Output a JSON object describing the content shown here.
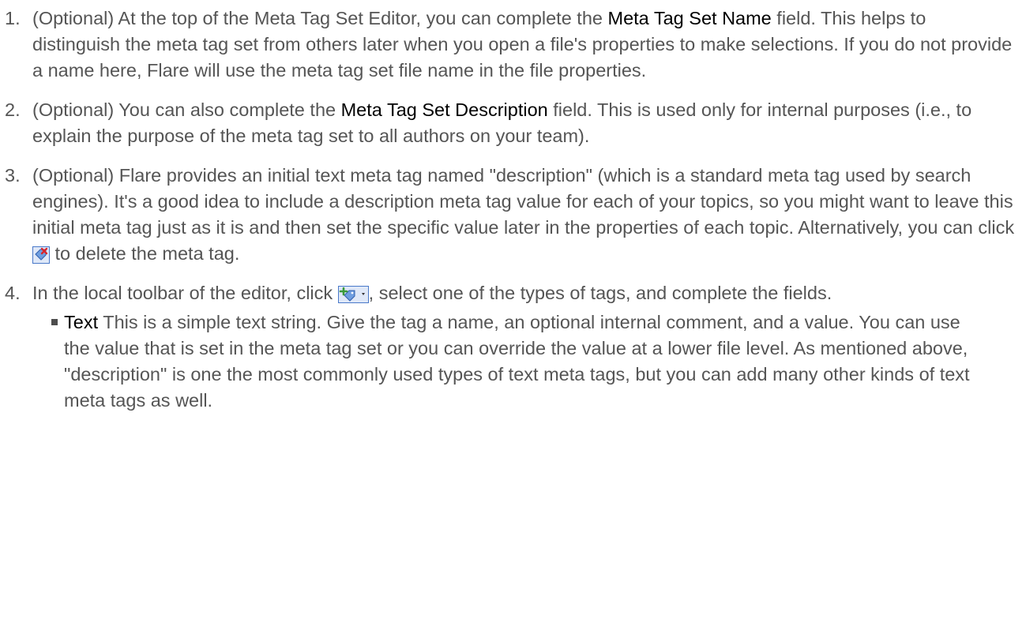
{
  "steps": [
    {
      "num": "1.",
      "pre": "(Optional) At the top of the Meta Tag Set Editor, you can complete the ",
      "strong": "Meta Tag Set Name",
      "post": " field. This helps to distinguish the meta tag set from others later when you open a file's properties to make selections. If you do not provide a name here, Flare will use the meta tag set file name in the file properties."
    },
    {
      "num": "2.",
      "pre": "(Optional) You can also complete the ",
      "strong": "Meta Tag Set Description",
      "post": " field. This is used only for internal purposes (i.e., to explain the purpose of the meta tag set to all authors on your team)."
    },
    {
      "num": "3.",
      "pre": "(Optional) Flare provides an initial text meta tag named \"description\" (which is a standard meta tag used by search engines). It's a good idea to include a description meta tag value for each of your topics, so you might want to leave this initial meta tag just as it is and then set the specific value later in the properties of each topic. Alternatively, you can click ",
      "icon": "delete-meta-tag-icon",
      "post": " to delete the meta tag."
    },
    {
      "num": "4.",
      "pre": "In the local toolbar of the editor, click ",
      "icon": "add-meta-tag-dropdown-icon",
      "post": ", select one of the types of tags, and complete the fields."
    }
  ],
  "bullets": [
    {
      "strong": "Text",
      "text": " This is a simple text string. Give the tag a name, an optional internal comment, and a value. You can use the value that is set in the meta tag set or you can override the value at a lower file level. As mentioned above, \"description\" is one the most commonly used types of text meta tags, but you can add many other kinds of text meta tags as well."
    }
  ],
  "colors": {
    "body_text": "#555555",
    "emphasis_text": "#000000",
    "icon_border": "#4a79c9",
    "icon_red": "#d9262c",
    "icon_green": "#3a9a3a"
  }
}
